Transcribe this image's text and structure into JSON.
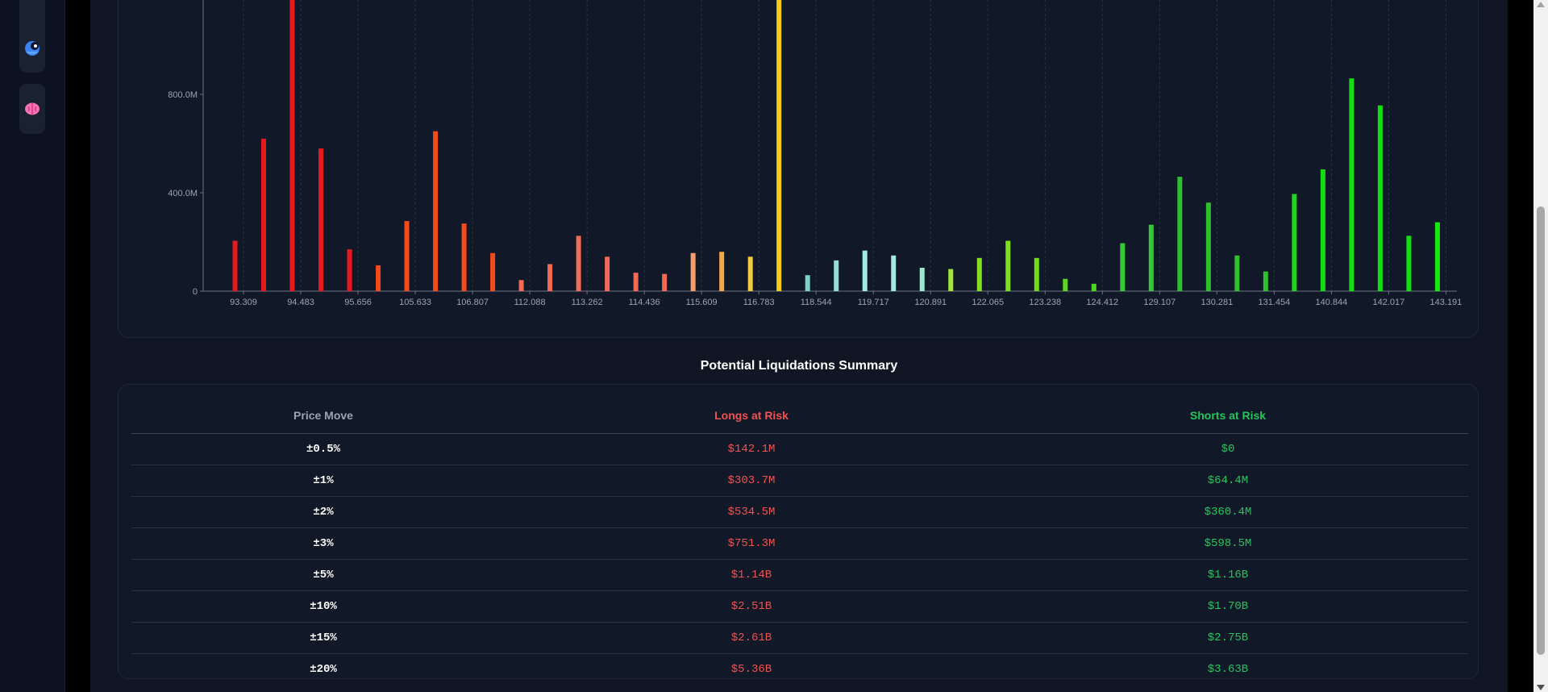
{
  "sidebar": {
    "items": [
      {
        "icon": "blue-creature-icon"
      },
      {
        "icon": "pink-brain-icon"
      }
    ]
  },
  "chart_data": {
    "type": "bar",
    "y_ticks": [
      "0",
      "400.0M",
      "800.0M"
    ],
    "ylim_millions": [
      0,
      1180
    ],
    "x_tick_labels": [
      "93.309",
      "94.483",
      "95.656",
      "105.633",
      "106.807",
      "112.088",
      "113.262",
      "114.436",
      "115.609",
      "116.783",
      "118.544",
      "119.717",
      "120.891",
      "122.065",
      "123.238",
      "124.412",
      "129.107",
      "130.281",
      "131.454",
      "140.844",
      "142.017",
      "143.191"
    ],
    "bars_millions": [
      {
        "v": 205,
        "c": "#e8191c"
      },
      {
        "v": 620,
        "c": "#e8191c"
      },
      {
        "v": 1200,
        "c": "#e8191c"
      },
      {
        "v": 580,
        "c": "#e8191c"
      },
      {
        "v": 170,
        "c": "#e8191c"
      },
      {
        "v": 105,
        "c": "#f24a1a"
      },
      {
        "v": 285,
        "c": "#f24a1a"
      },
      {
        "v": 650,
        "c": "#f24a1a"
      },
      {
        "v": 275,
        "c": "#f24a1a"
      },
      {
        "v": 155,
        "c": "#f24a1a"
      },
      {
        "v": 45,
        "c": "#f06a55"
      },
      {
        "v": 110,
        "c": "#f06a55"
      },
      {
        "v": 225,
        "c": "#f06a55"
      },
      {
        "v": 140,
        "c": "#f06a55"
      },
      {
        "v": 75,
        "c": "#f06a55"
      },
      {
        "v": 70,
        "c": "#f06a55"
      },
      {
        "v": 155,
        "c": "#f59e6a"
      },
      {
        "v": 160,
        "c": "#f5a84a"
      },
      {
        "v": 140,
        "c": "#f5c842"
      },
      {
        "v": 1200,
        "c": "#facc15"
      },
      {
        "v": 65,
        "c": "#7dd3c8"
      },
      {
        "v": 125,
        "c": "#93e0d8"
      },
      {
        "v": 165,
        "c": "#a5e8e0"
      },
      {
        "v": 145,
        "c": "#a5e8e0"
      },
      {
        "v": 95,
        "c": "#9be8d0"
      },
      {
        "v": 90,
        "c": "#a3e635"
      },
      {
        "v": 135,
        "c": "#84e01f"
      },
      {
        "v": 205,
        "c": "#7ee01a"
      },
      {
        "v": 135,
        "c": "#6fdc1c"
      },
      {
        "v": 50,
        "c": "#5cd61e"
      },
      {
        "v": 30,
        "c": "#4ed31e"
      },
      {
        "v": 195,
        "c": "#36c836"
      },
      {
        "v": 270,
        "c": "#36c836"
      },
      {
        "v": 465,
        "c": "#2fbf2f"
      },
      {
        "v": 360,
        "c": "#2fbf2f"
      },
      {
        "v": 145,
        "c": "#2fbf2f"
      },
      {
        "v": 80,
        "c": "#2fbf2f"
      },
      {
        "v": 395,
        "c": "#1fd41f"
      },
      {
        "v": 495,
        "c": "#14dc14"
      },
      {
        "v": 865,
        "c": "#12e012"
      },
      {
        "v": 755,
        "c": "#10e010"
      },
      {
        "v": 225,
        "c": "#10e010"
      },
      {
        "v": 280,
        "c": "#12e812"
      }
    ]
  },
  "summary": {
    "title": "Potential Liquidations Summary",
    "headers": {
      "move": "Price Move",
      "longs": "Longs at Risk",
      "shorts": "Shorts at Risk"
    },
    "rows": [
      {
        "move": "±0.5%",
        "longs": "$142.1M",
        "shorts": "$0"
      },
      {
        "move": "±1%",
        "longs": "$303.7M",
        "shorts": "$64.4M"
      },
      {
        "move": "±2%",
        "longs": "$534.5M",
        "shorts": "$360.4M"
      },
      {
        "move": "±3%",
        "longs": "$751.3M",
        "shorts": "$598.5M"
      },
      {
        "move": "±5%",
        "longs": "$1.14B",
        "shorts": "$1.16B"
      },
      {
        "move": "±10%",
        "longs": "$2.51B",
        "shorts": "$1.70B"
      },
      {
        "move": "±15%",
        "longs": "$2.61B",
        "shorts": "$2.75B"
      },
      {
        "move": "±20%",
        "longs": "$5.36B",
        "shorts": "$3.63B"
      }
    ]
  }
}
